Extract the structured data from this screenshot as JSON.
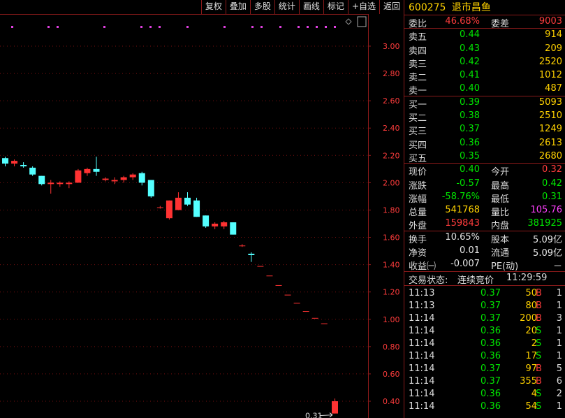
{
  "toolbar": [
    "复权",
    "叠加",
    "多股",
    "统计",
    "画线",
    "标记",
    "+自选",
    "返回"
  ],
  "chart_data": {
    "type": "candlestick",
    "y_ticks": [
      "3.00",
      "2.80",
      "2.60",
      "2.40",
      "2.20",
      "2.00",
      "1.80",
      "1.60",
      "1.40",
      "1.20",
      "1.00",
      "0.80",
      "0.60",
      "0.40"
    ],
    "ylim": [
      0.29,
      3.2
    ],
    "grid": "horizontal dotted",
    "low_label": "0.31",
    "candles": [
      {
        "o": 2.18,
        "h": 2.19,
        "l": 2.12,
        "c": 2.14
      },
      {
        "o": 2.14,
        "h": 2.17,
        "l": 2.12,
        "c": 2.16
      },
      {
        "o": 2.13,
        "h": 2.15,
        "l": 2.11,
        "c": 2.12
      },
      {
        "o": 2.11,
        "h": 2.12,
        "l": 2.05,
        "c": 2.06
      },
      {
        "o": 2.05,
        "h": 2.05,
        "l": 1.98,
        "c": 1.99
      },
      {
        "o": 1.99,
        "h": 2.02,
        "l": 1.92,
        "c": 2.0
      },
      {
        "o": 1.99,
        "h": 2.01,
        "l": 1.97,
        "c": 2.0
      },
      {
        "o": 1.99,
        "h": 2.01,
        "l": 1.96,
        "c": 2.0
      },
      {
        "o": 2.0,
        "h": 2.1,
        "l": 2.0,
        "c": 2.09
      },
      {
        "o": 2.07,
        "h": 2.11,
        "l": 2.05,
        "c": 2.1
      },
      {
        "o": 2.1,
        "h": 2.19,
        "l": 2.05,
        "c": 2.08
      },
      {
        "o": 2.02,
        "h": 2.04,
        "l": 2.01,
        "c": 2.03
      },
      {
        "o": 2.01,
        "h": 2.04,
        "l": 1.99,
        "c": 2.02
      },
      {
        "o": 2.02,
        "h": 2.05,
        "l": 2.0,
        "c": 2.04
      },
      {
        "o": 2.04,
        "h": 2.07,
        "l": 2.02,
        "c": 2.06
      },
      {
        "o": 2.07,
        "h": 2.08,
        "l": 1.98,
        "c": 2.0
      },
      {
        "o": 2.02,
        "h": 2.02,
        "l": 1.89,
        "c": 1.9
      },
      {
        "o": 1.82,
        "h": 1.83,
        "l": 1.81,
        "c": 1.82
      },
      {
        "o": 1.74,
        "h": 1.87,
        "l": 1.73,
        "c": 1.87
      },
      {
        "o": 1.8,
        "h": 1.93,
        "l": 1.8,
        "c": 1.89
      },
      {
        "o": 1.89,
        "h": 1.93,
        "l": 1.83,
        "c": 1.84
      },
      {
        "o": 1.87,
        "h": 1.89,
        "l": 1.75,
        "c": 1.75
      },
      {
        "o": 1.76,
        "h": 1.76,
        "l": 1.67,
        "c": 1.68
      },
      {
        "o": 1.68,
        "h": 1.71,
        "l": 1.66,
        "c": 1.7
      },
      {
        "o": 1.68,
        "h": 1.72,
        "l": 1.66,
        "c": 1.71
      },
      {
        "o": 1.71,
        "h": 1.71,
        "l": 1.62,
        "c": 1.62
      },
      {
        "o": 1.54,
        "h": 1.55,
        "l": 1.53,
        "c": 1.54
      },
      {
        "o": 1.48,
        "h": 1.49,
        "l": 1.42,
        "c": 1.47
      },
      {
        "o": 1.39,
        "h": 1.39,
        "l": 1.39,
        "c": 1.39
      },
      {
        "o": 1.32,
        "h": 1.32,
        "l": 1.32,
        "c": 1.32
      },
      {
        "o": 1.25,
        "h": 1.25,
        "l": 1.25,
        "c": 1.25
      },
      {
        "o": 1.18,
        "h": 1.18,
        "l": 1.18,
        "c": 1.18
      },
      {
        "o": 1.12,
        "h": 1.12,
        "l": 1.12,
        "c": 1.12
      },
      {
        "o": 1.06,
        "h": 1.06,
        "l": 1.06,
        "c": 1.06
      },
      {
        "o": 1.01,
        "h": 1.01,
        "l": 1.01,
        "c": 1.01
      },
      {
        "o": 0.97,
        "h": 0.97,
        "l": 0.97,
        "c": 0.97
      },
      {
        "o": 0.31,
        "h": 0.42,
        "l": 0.31,
        "c": 0.4
      }
    ],
    "marker_count": 19
  },
  "panel": {
    "code": "600275",
    "name": "退市昌鱼",
    "weibi_label": "委比",
    "weibi": "46.68%",
    "weicha_label": "委差",
    "weicha": "9003",
    "asks": [
      {
        "label": "卖五",
        "price": "0.44",
        "vol": "914"
      },
      {
        "label": "卖四",
        "price": "0.43",
        "vol": "209"
      },
      {
        "label": "卖三",
        "price": "0.42",
        "vol": "2520"
      },
      {
        "label": "卖二",
        "price": "0.41",
        "vol": "1012"
      },
      {
        "label": "卖一",
        "price": "0.40",
        "vol": "487"
      }
    ],
    "bids": [
      {
        "label": "买一",
        "price": "0.39",
        "vol": "5093"
      },
      {
        "label": "买二",
        "price": "0.38",
        "vol": "2510"
      },
      {
        "label": "买三",
        "price": "0.37",
        "vol": "1249"
      },
      {
        "label": "买四",
        "price": "0.36",
        "vol": "2613"
      },
      {
        "label": "买五",
        "price": "0.35",
        "vol": "2680"
      }
    ],
    "quote": [
      {
        "l1": "现价",
        "v1": "0.40",
        "l2": "今开",
        "v2": "0.32"
      },
      {
        "l1": "涨跌",
        "v1": "-0.57",
        "l2": "最高",
        "v2": "0.42"
      },
      {
        "l1": "涨幅",
        "v1": "-58.76%",
        "l2": "最低",
        "v2": "0.31"
      },
      {
        "l1": "总量",
        "v1": "541768",
        "l2": "量比",
        "v2": "105.76"
      },
      {
        "l1": "外盘",
        "v1": "159843",
        "l2": "内盘",
        "v2": "381925"
      }
    ],
    "extra": [
      {
        "l1": "换手",
        "v1": "10.65%",
        "l2": "股本",
        "v2": "5.09亿"
      },
      {
        "l1": "净资",
        "v1": "0.01",
        "l2": "流通",
        "v2": "5.09亿"
      },
      {
        "l1": "收益㈠",
        "v1": "-0.007",
        "l2": "PE(动)",
        "v2": "－"
      }
    ],
    "status_label": "交易状态:",
    "status_value": "连续竞价",
    "status_time": "11:29:59",
    "trades": [
      {
        "t": "11:13",
        "p": "0.37",
        "v": "50",
        "s": "B",
        "n": "1"
      },
      {
        "t": "11:13",
        "p": "0.37",
        "v": "80",
        "s": "B",
        "n": "1"
      },
      {
        "t": "11:14",
        "p": "0.37",
        "v": "200",
        "s": "B",
        "n": "3"
      },
      {
        "t": "11:14",
        "p": "0.36",
        "v": "20",
        "s": "S",
        "n": "1"
      },
      {
        "t": "11:14",
        "p": "0.36",
        "v": "2",
        "s": "S",
        "n": "1"
      },
      {
        "t": "11:14",
        "p": "0.36",
        "v": "17",
        "s": "S",
        "n": "1"
      },
      {
        "t": "11:14",
        "p": "0.37",
        "v": "97",
        "s": "B",
        "n": "5"
      },
      {
        "t": "11:14",
        "p": "0.37",
        "v": "355",
        "s": "B",
        "n": "6"
      },
      {
        "t": "11:14",
        "p": "0.36",
        "v": "4",
        "s": "S",
        "n": "2"
      },
      {
        "t": "11:14",
        "p": "0.36",
        "v": "54",
        "s": "S",
        "n": "1"
      }
    ]
  }
}
